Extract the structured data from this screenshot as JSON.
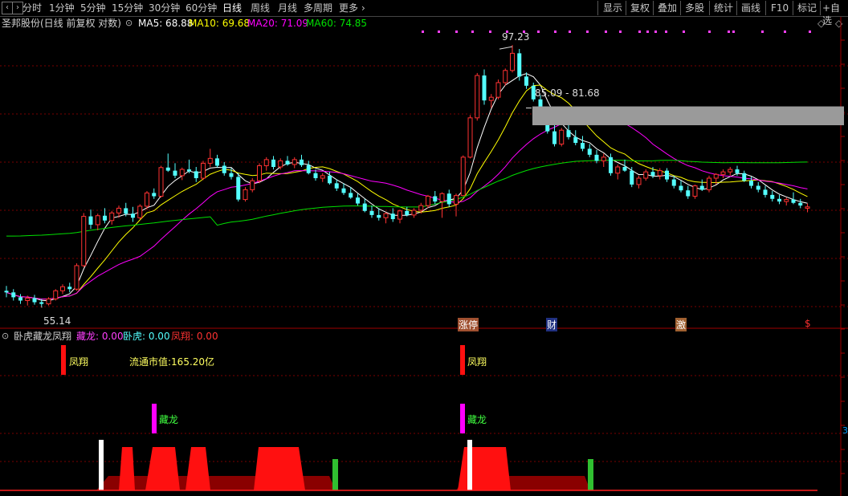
{
  "toolbar": {
    "nav_icons": [
      "chevron-left-icon",
      "chevron-right-icon"
    ],
    "periods": [
      "分时",
      "1分钟",
      "5分钟",
      "15分钟",
      "30分钟",
      "60分钟",
      "日线",
      "周线",
      "月线",
      "多周期",
      "更多"
    ],
    "active_period": "日线",
    "right_buttons": [
      "显示",
      "复权",
      "叠加",
      "多股",
      "统计",
      "画线",
      "F10",
      "标记",
      "+自选"
    ]
  },
  "info": {
    "title": "圣邦股份(日线 前复权 对数)",
    "ma5": "MA5: 68.88",
    "ma10": "MA10: 69.68",
    "ma20": "MA20: 71.09",
    "ma60": "MA60: 74.85"
  },
  "price_chart": {
    "high_label": "97.23",
    "low_label": "55.14",
    "zone_label": "85.09 - 81.68",
    "event_tags": [
      "涨停",
      "财",
      "激",
      "$"
    ]
  },
  "indicator": {
    "title": "卧虎藏龙凤翔",
    "cang_long": "藏龙: 0.00",
    "wo_hu": "卧虎: 0.00",
    "feng_xiang": "凤翔: 0.00",
    "signal_fx": "凤翔",
    "signal_cl": "藏龙",
    "market_cap": "流通市值:165.20亿",
    "axis_mark": "3"
  },
  "colors": {
    "up": "#ff3232",
    "down": "#54ffff",
    "ma5": "#ffffff",
    "ma10": "#ffff00",
    "ma20": "#ff00ff",
    "ma60": "#00e000",
    "grid": "#7a0000"
  },
  "chart_data": {
    "type": "candlestick",
    "ylim_log": [
      53,
      100
    ],
    "candles": [
      [
        57.0,
        57.6,
        56.2,
        56.8
      ],
      [
        56.8,
        57.2,
        55.8,
        56.2
      ],
      [
        56.2,
        56.6,
        55.4,
        55.8
      ],
      [
        55.8,
        56.4,
        55.2,
        56.1
      ],
      [
        56.1,
        56.5,
        55.3,
        55.6
      ],
      [
        55.6,
        56.0,
        55.14,
        55.4
      ],
      [
        55.4,
        56.2,
        55.2,
        56.0
      ],
      [
        56.0,
        57.2,
        55.8,
        57.0
      ],
      [
        57.0,
        57.8,
        56.6,
        57.5
      ],
      [
        57.5,
        58.0,
        56.8,
        57.2
      ],
      [
        57.2,
        60.5,
        57.0,
        60.2
      ],
      [
        60.2,
        67.5,
        60.0,
        67.0
      ],
      [
        67.0,
        68.0,
        65.2,
        65.8
      ],
      [
        65.8,
        67.4,
        65.0,
        67.1
      ],
      [
        67.1,
        68.2,
        66.0,
        66.4
      ],
      [
        66.4,
        67.8,
        65.8,
        67.5
      ],
      [
        67.5,
        68.6,
        66.8,
        68.2
      ],
      [
        68.2,
        69.0,
        67.0,
        67.4
      ],
      [
        67.4,
        68.4,
        66.2,
        66.8
      ],
      [
        66.8,
        68.8,
        66.6,
        68.5
      ],
      [
        68.5,
        70.8,
        68.0,
        70.5
      ],
      [
        70.5,
        71.2,
        69.6,
        70.0
      ],
      [
        70.0,
        74.8,
        69.8,
        74.5
      ],
      [
        74.5,
        76.8,
        73.8,
        74.0
      ],
      [
        74.0,
        75.2,
        72.8,
        73.2
      ],
      [
        73.2,
        74.5,
        72.5,
        74.2
      ],
      [
        74.2,
        75.8,
        73.6,
        73.9
      ],
      [
        73.9,
        74.6,
        72.2,
        72.8
      ],
      [
        72.8,
        75.6,
        72.5,
        75.2
      ],
      [
        75.2,
        77.6,
        74.6,
        76.0
      ],
      [
        76.0,
        76.6,
        74.5,
        74.8
      ],
      [
        74.8,
        75.4,
        73.2,
        73.6
      ],
      [
        73.6,
        74.4,
        72.6,
        73.0
      ],
      [
        73.0,
        73.6,
        69.2,
        69.5
      ],
      [
        69.5,
        71.4,
        69.2,
        71.0
      ],
      [
        71.0,
        72.8,
        70.6,
        72.4
      ],
      [
        72.4,
        75.2,
        72.0,
        74.8
      ],
      [
        74.8,
        76.2,
        74.0,
        75.8
      ],
      [
        75.8,
        76.4,
        74.2,
        74.6
      ],
      [
        74.6,
        76.0,
        74.2,
        75.6
      ],
      [
        75.6,
        76.4,
        74.8,
        75.0
      ],
      [
        75.0,
        76.2,
        74.4,
        75.8
      ],
      [
        75.8,
        76.6,
        74.6,
        74.9
      ],
      [
        74.9,
        75.6,
        73.4,
        73.6
      ],
      [
        73.6,
        74.2,
        72.4,
        72.8
      ],
      [
        72.8,
        73.6,
        72.2,
        73.2
      ],
      [
        73.2,
        73.8,
        71.8,
        72.0
      ],
      [
        72.0,
        72.6,
        70.8,
        71.2
      ],
      [
        71.2,
        72.0,
        70.2,
        70.5
      ],
      [
        70.5,
        71.4,
        69.6,
        69.8
      ],
      [
        69.8,
        70.4,
        68.6,
        68.9
      ],
      [
        68.9,
        69.6,
        67.6,
        67.8
      ],
      [
        67.8,
        68.6,
        66.8,
        67.2
      ],
      [
        67.2,
        68.2,
        66.4,
        66.8
      ],
      [
        66.8,
        67.6,
        66.0,
        67.4
      ],
      [
        67.4,
        68.2,
        66.2,
        66.6
      ],
      [
        66.6,
        68.0,
        66.0,
        67.8
      ],
      [
        67.8,
        68.4,
        67.0,
        67.2
      ],
      [
        67.2,
        68.2,
        66.8,
        67.9
      ],
      [
        67.9,
        69.0,
        67.4,
        68.6
      ],
      [
        68.6,
        70.2,
        68.2,
        70.0
      ],
      [
        70.0,
        70.8,
        68.8,
        69.2
      ],
      [
        69.2,
        70.6,
        66.8,
        70.4
      ],
      [
        70.4,
        71.0,
        68.4,
        68.8
      ],
      [
        68.8,
        70.4,
        67.0,
        70.1
      ],
      [
        70.1,
        76.5,
        70.0,
        76.2
      ],
      [
        76.2,
        83.5,
        76.0,
        83.0
      ],
      [
        83.0,
        91.5,
        82.5,
        91.0
      ],
      [
        91.0,
        92.2,
        85.4,
        86.2
      ],
      [
        86.2,
        87.4,
        84.8,
        86.8
      ],
      [
        86.8,
        90.2,
        86.4,
        89.6
      ],
      [
        89.6,
        92.4,
        89.0,
        92.0
      ],
      [
        92.0,
        97.23,
        91.6,
        95.5
      ],
      [
        95.5,
        96.4,
        90.0,
        90.8
      ],
      [
        90.8,
        91.6,
        88.4,
        89.0
      ],
      [
        89.0,
        89.6,
        86.0,
        86.4
      ],
      [
        86.4,
        87.2,
        83.6,
        83.9
      ],
      [
        83.9,
        84.4,
        80.2,
        80.6
      ],
      [
        80.6,
        81.8,
        78.0,
        78.4
      ],
      [
        78.4,
        81.2,
        78.0,
        80.8
      ],
      [
        80.8,
        82.0,
        79.2,
        79.6
      ],
      [
        79.6,
        80.8,
        78.2,
        78.6
      ],
      [
        78.6,
        79.8,
        77.2,
        77.6
      ],
      [
        77.6,
        78.4,
        76.2,
        76.6
      ],
      [
        76.6,
        77.4,
        75.2,
        75.6
      ],
      [
        75.6,
        76.8,
        74.6,
        76.2
      ],
      [
        76.2,
        76.8,
        73.2,
        73.6
      ],
      [
        73.6,
        75.0,
        72.6,
        74.6
      ],
      [
        74.6,
        75.8,
        73.8,
        74.0
      ],
      [
        74.0,
        74.6,
        71.4,
        71.8
      ],
      [
        71.8,
        73.2,
        71.2,
        72.8
      ],
      [
        72.8,
        74.2,
        72.4,
        73.8
      ],
      [
        73.8,
        74.6,
        72.8,
        73.2
      ],
      [
        73.2,
        74.4,
        72.6,
        74.0
      ],
      [
        74.0,
        74.4,
        72.2,
        72.6
      ],
      [
        72.6,
        73.2,
        71.2,
        71.6
      ],
      [
        71.6,
        72.4,
        70.6,
        70.9
      ],
      [
        70.9,
        71.6,
        69.6,
        70.0
      ],
      [
        70.0,
        71.8,
        69.6,
        71.6
      ],
      [
        71.6,
        72.6,
        70.8,
        71.0
      ],
      [
        71.0,
        73.2,
        70.6,
        72.8
      ],
      [
        72.8,
        73.6,
        71.8,
        73.4
      ],
      [
        73.4,
        74.2,
        72.8,
        73.8
      ],
      [
        73.8,
        74.6,
        73.2,
        74.2
      ],
      [
        74.2,
        74.8,
        73.2,
        73.6
      ],
      [
        73.6,
        74.0,
        72.2,
        72.4
      ],
      [
        72.4,
        73.0,
        71.2,
        71.6
      ],
      [
        71.6,
        72.2,
        70.6,
        71.0
      ],
      [
        71.0,
        71.6,
        69.8,
        70.2
      ],
      [
        70.2,
        70.8,
        69.2,
        69.6
      ],
      [
        69.6,
        70.2,
        68.8,
        69.2
      ],
      [
        69.2,
        69.8,
        68.6,
        69.5
      ],
      [
        69.5,
        70.6,
        68.8,
        69.0
      ],
      [
        69.0,
        69.6,
        68.2,
        68.6
      ],
      [
        68.2,
        68.9,
        67.6,
        68.4
      ]
    ]
  }
}
